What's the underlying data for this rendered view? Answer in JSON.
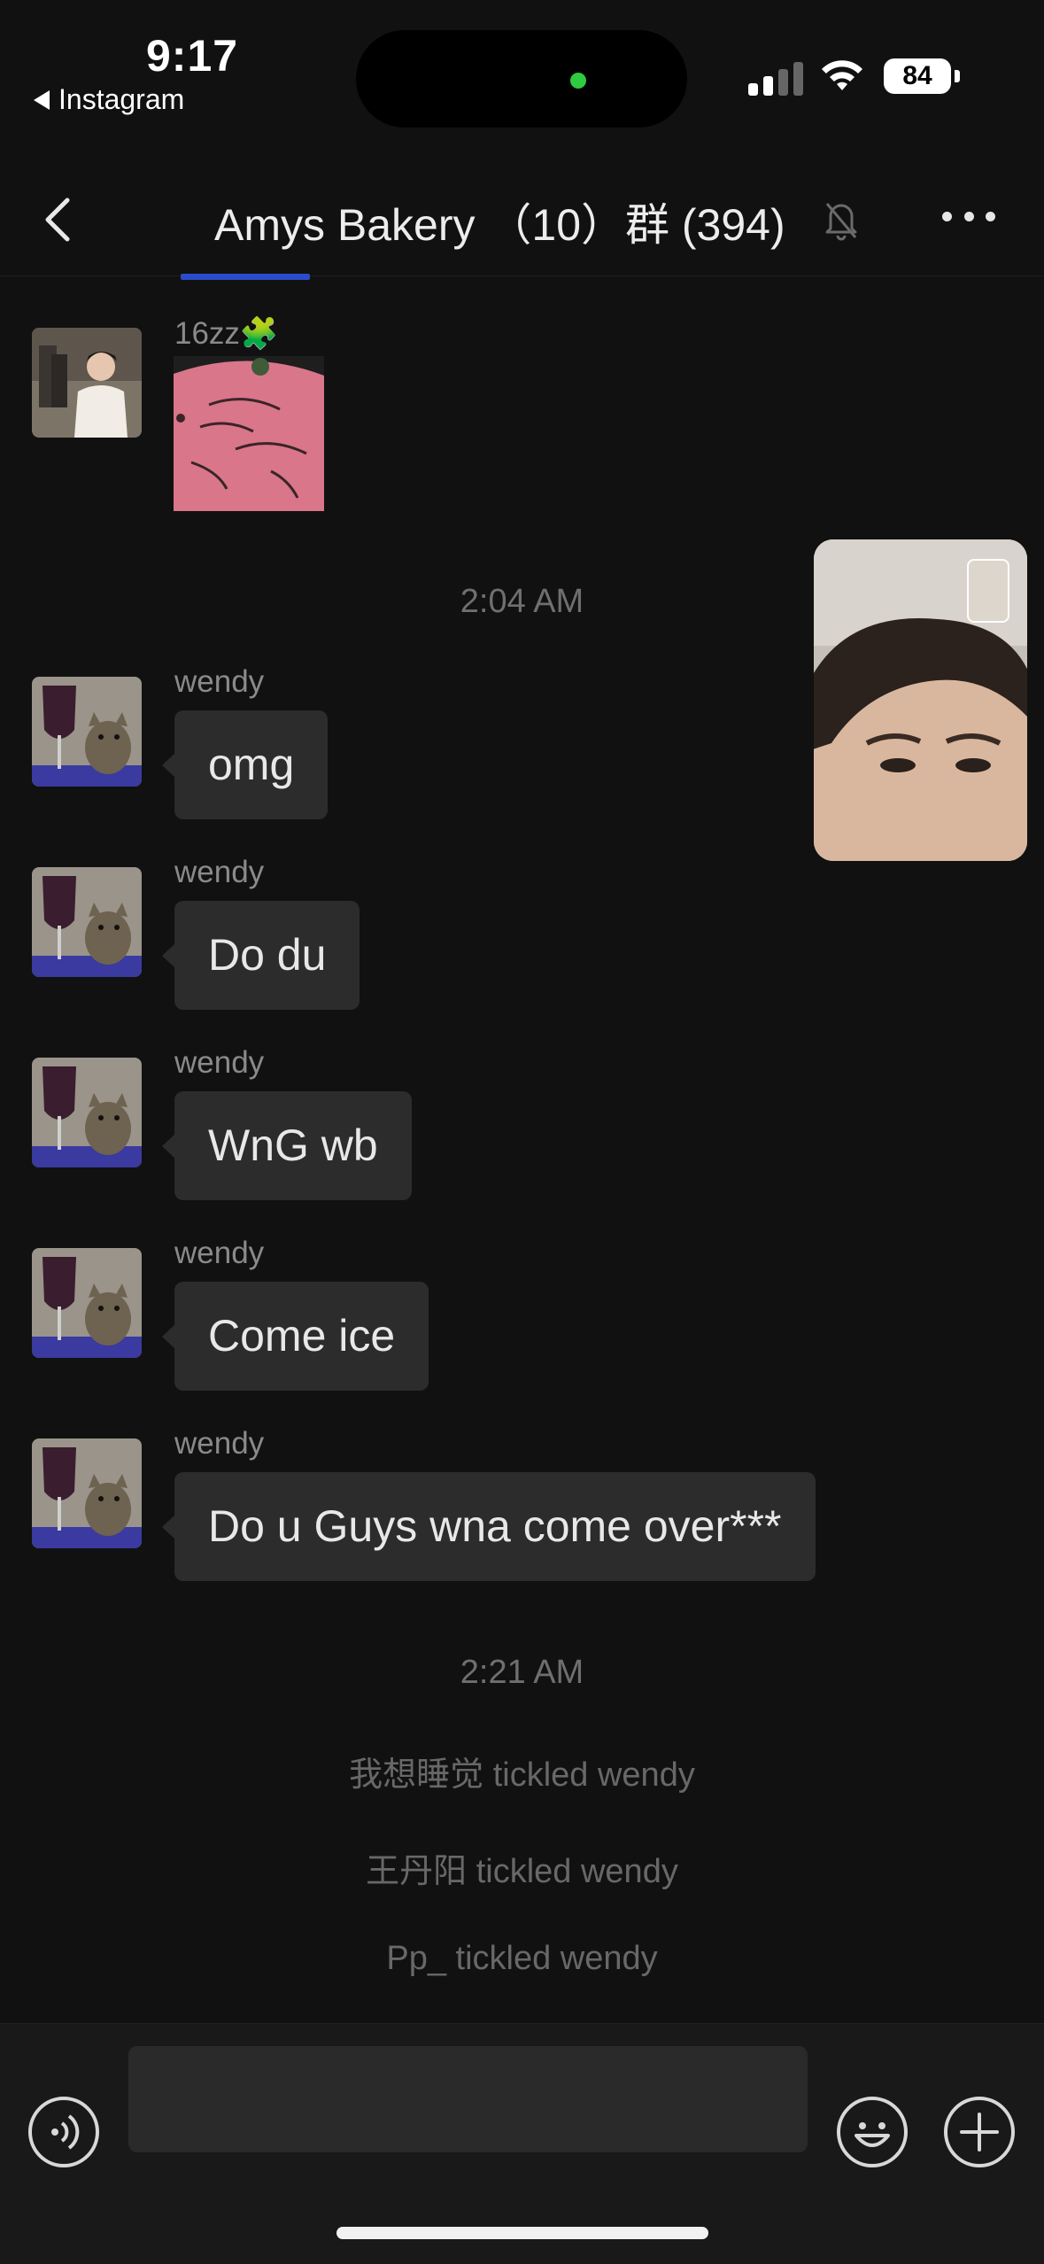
{
  "status_bar": {
    "time": "9:17",
    "back_app_label": "Instagram",
    "battery": "84",
    "signal_bars": 2
  },
  "header": {
    "title": "Amys Bakery （10）群 (394)",
    "muted": true
  },
  "messages": [
    {
      "sender": "16zz🧩",
      "type": "sticker"
    },
    {
      "type": "timestamp",
      "text": "2:04 AM"
    },
    {
      "sender": "wendy",
      "text": "omg"
    },
    {
      "sender": "wendy",
      "text": "Do du"
    },
    {
      "sender": "wendy",
      "text": "WnG wb"
    },
    {
      "sender": "wendy",
      "text": "Come ice"
    },
    {
      "sender": "wendy",
      "text": "Do u Guys wna come over***"
    },
    {
      "type": "timestamp",
      "text": "2:21 AM"
    }
  ],
  "system_messages": [
    "我想睡觉 tickled wendy",
    "王丹阳 tickled wendy",
    "Pp_ tickled wendy"
  ],
  "input": {
    "value": "",
    "placeholder": ""
  },
  "icons": {
    "back": "chevron-left-icon",
    "mute": "bell-slash-icon",
    "more": "more-dots-icon",
    "voice": "voice-icon",
    "emoji": "smiley-icon",
    "plus": "plus-icon"
  },
  "colors": {
    "background": "#111111",
    "bubble": "#2c2c2c",
    "input_bar": "#191919"
  }
}
